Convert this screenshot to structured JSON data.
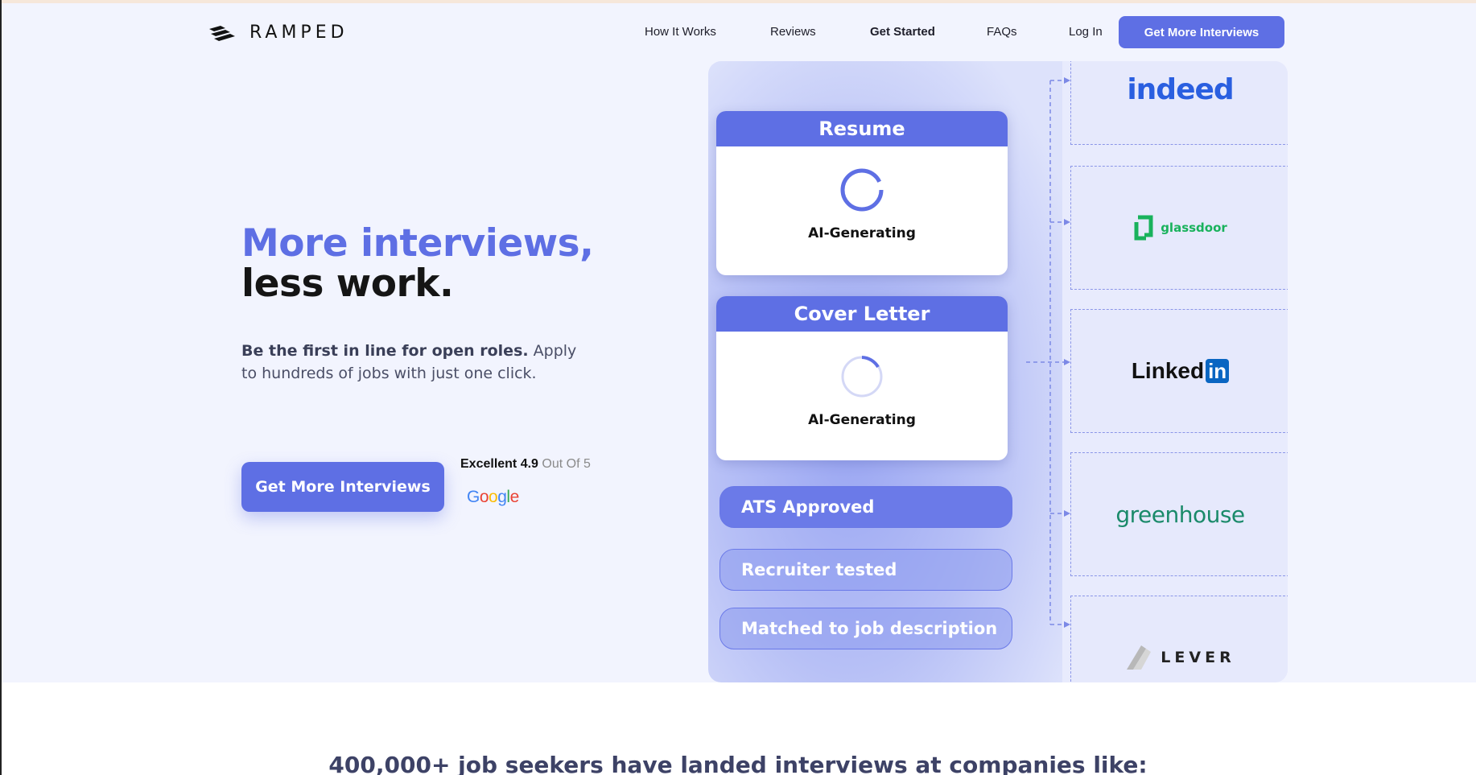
{
  "brand": {
    "name": "RAMPED"
  },
  "nav": {
    "links": [
      "How It Works",
      "Reviews",
      "Get Started",
      "FAQs",
      "Log In"
    ],
    "cta": "Get More Interviews"
  },
  "hero": {
    "headline_line1": "More interviews,",
    "headline_line2": "less work.",
    "sub_bold": "Be the first in line for open roles.",
    "sub_rest": " Apply to hundreds of jobs with just one click.",
    "cta": "Get More Interviews",
    "rating_label": "Excellent 4.9",
    "rating_suffix": "Out Of 5",
    "rating_source": "Google"
  },
  "panel": {
    "cards": [
      {
        "title": "Resume",
        "status": "AI-Generating"
      },
      {
        "title": "Cover Letter",
        "status": "AI-Generating"
      }
    ],
    "pills": [
      "ATS Approved",
      "Recruiter tested",
      "Matched to job description"
    ],
    "companies": [
      "indeed",
      "glassdoor",
      "Linked",
      "in",
      "greenhouse",
      "LEVER"
    ]
  },
  "social_proof": "400,000+ job seekers have landed interviews at companies like:",
  "colors": {
    "accent": "#5e6fe4",
    "hero_bg": "#f2f4fe",
    "text_dark": "#151515"
  }
}
